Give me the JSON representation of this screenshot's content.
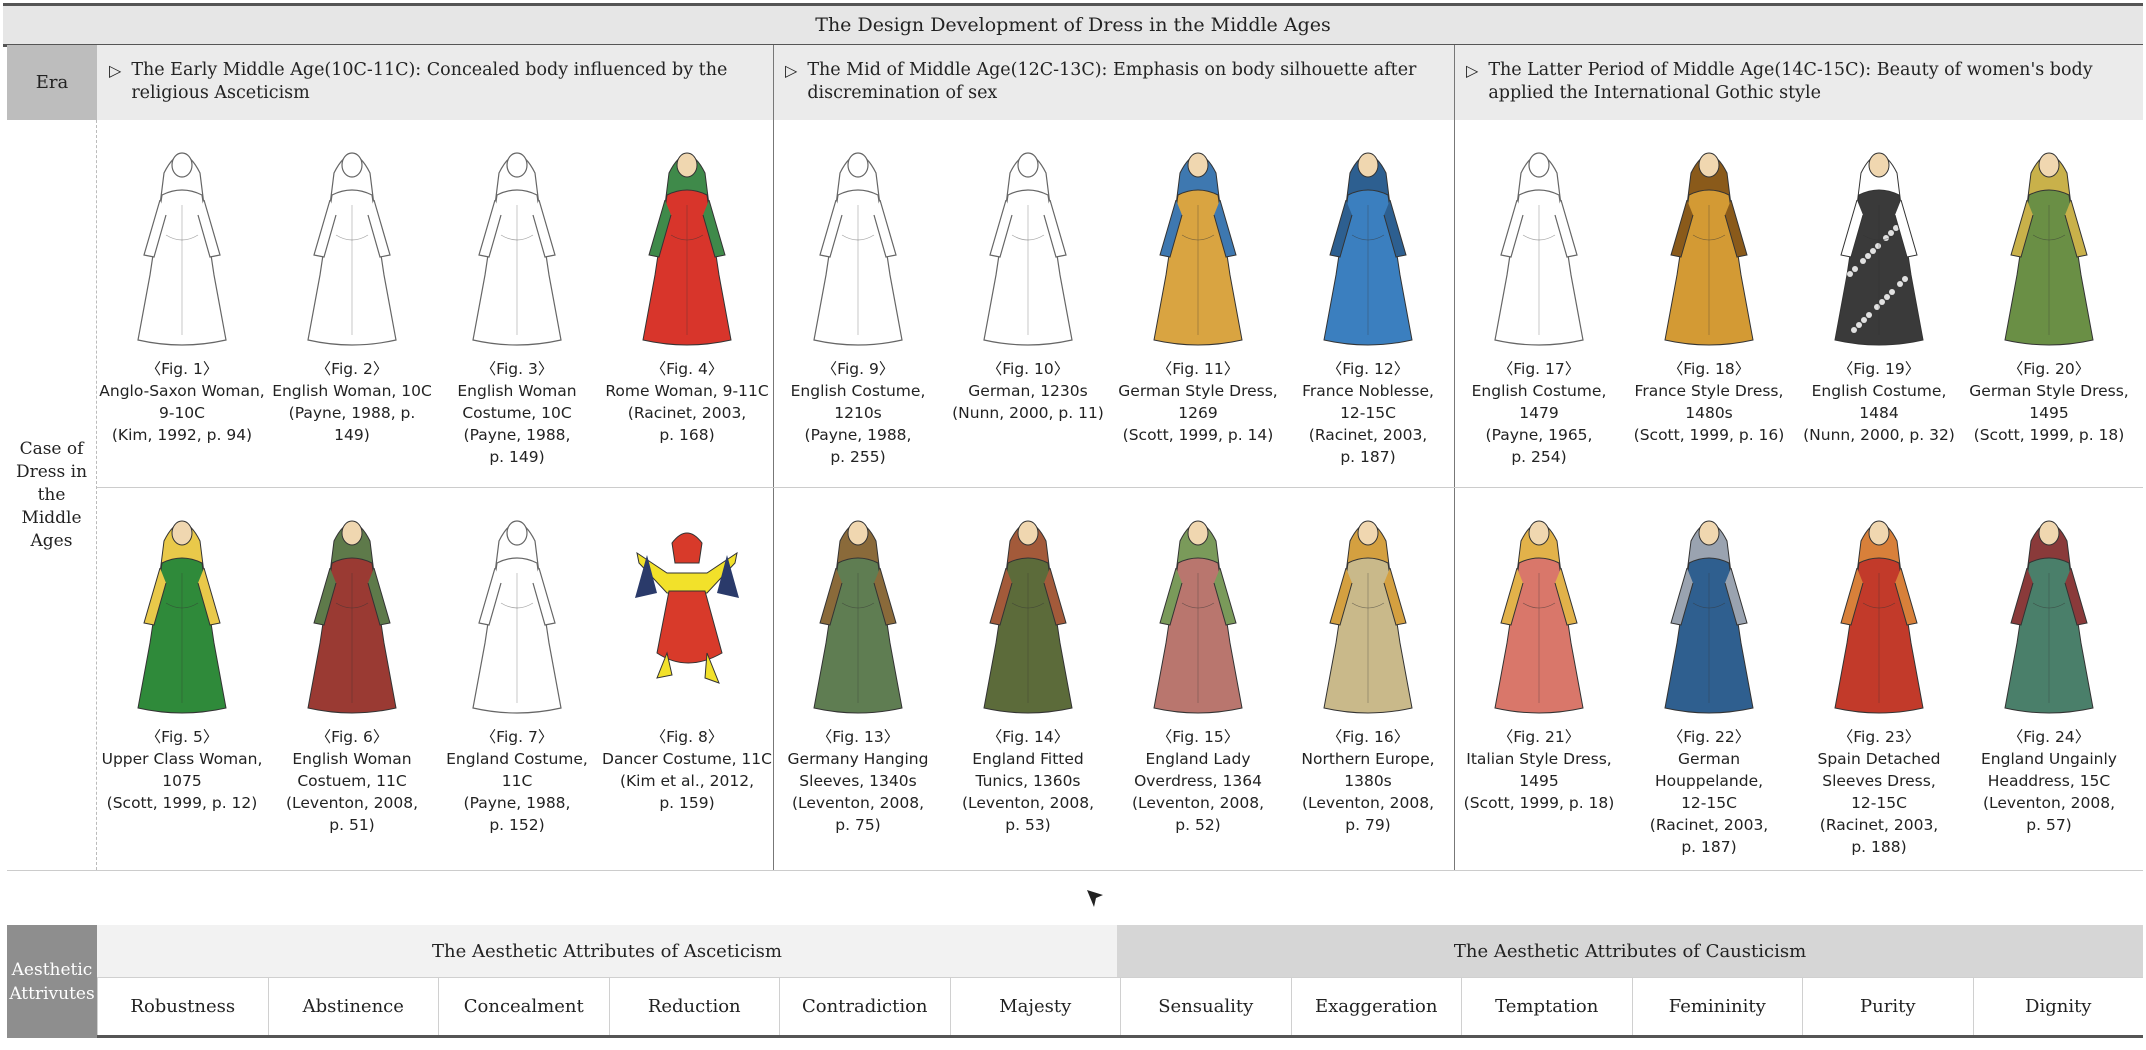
{
  "title": "The Design Development of Dress in the Middle Ages",
  "era_label": "Era",
  "case_label": "Case of\nDress in\nthe\nMiddle\nAges",
  "periods": [
    {
      "text": "The Early Middle Age(10C-11C): Concealed body influenced by the religious Asceticism"
    },
    {
      "text": "The Mid of Middle Age(12C-13C): Emphasis on body silhouette after discremination of sex"
    },
    {
      "text": "The Latter Period of Middle Age(14C-15C): Beauty of women's body applied the International Gothic style"
    }
  ],
  "figures": [
    {
      "num": "〈Fig. 1〉",
      "caption": "Anglo-Saxon Woman,\n9-10C\n(Kim, 1992, p. 94)",
      "style": "sketch",
      "dress": "#ffffff",
      "accent": "#ffffff"
    },
    {
      "num": "〈Fig. 2〉",
      "caption": "English Woman, 10C\n(Payne, 1988, p.\n149)",
      "style": "sketch",
      "dress": "#ffffff",
      "accent": "#ffffff"
    },
    {
      "num": "〈Fig. 3〉",
      "caption": "English Woman\nCostume, 10C\n(Payne, 1988,\np. 149)",
      "style": "sketch",
      "dress": "#ffffff",
      "accent": "#ffffff"
    },
    {
      "num": "〈Fig. 4〉",
      "caption": "Rome Woman, 9-11C\n(Racinet, 2003,\np. 168)",
      "style": "color",
      "dress": "#d8352b",
      "accent": "#3f8a4a"
    },
    {
      "num": "〈Fig. 9〉",
      "caption": "English Costume,\n1210s\n(Payne, 1988,\np. 255)",
      "style": "sketch",
      "dress": "#ffffff",
      "accent": "#ffffff"
    },
    {
      "num": "〈Fig. 10〉",
      "caption": "German, 1230s\n(Nunn, 2000, p. 11)",
      "style": "sketch",
      "dress": "#ffffff",
      "accent": "#ffffff"
    },
    {
      "num": "〈Fig. 11〉",
      "caption": "German Style Dress,\n1269\n(Scott, 1999, p. 14)",
      "style": "color",
      "dress": "#d9a441",
      "accent": "#3e78b0"
    },
    {
      "num": "〈Fig. 12〉",
      "caption": "France Noblesse,\n12-15C\n(Racinet, 2003,\np. 187)",
      "style": "color",
      "dress": "#3b7fbf",
      "accent": "#2d5f90"
    },
    {
      "num": "〈Fig. 17〉",
      "caption": "English Costume,\n1479\n(Payne, 1965,\np. 254)",
      "style": "sketch",
      "dress": "#ffffff",
      "accent": "#ffffff"
    },
    {
      "num": "〈Fig. 18〉",
      "caption": "France Style Dress,\n1480s\n(Scott, 1999, p. 16)",
      "style": "color",
      "dress": "#d39a34",
      "accent": "#8a5a1a"
    },
    {
      "num": "〈Fig. 19〉",
      "caption": "English Costume,\n1484\n(Nunn, 2000, p. 32)",
      "style": "pattern",
      "dress": "#3a3a3a",
      "accent": "#ffffff"
    },
    {
      "num": "〈Fig. 20〉",
      "caption": "German Style Dress,\n1495\n(Scott, 1999, p. 18)",
      "style": "color",
      "dress": "#6a8f45",
      "accent": "#c9b14a"
    },
    {
      "num": "〈Fig. 5〉",
      "caption": "Upper Class Woman,\n1075\n(Scott, 1999, p. 12)",
      "style": "color",
      "dress": "#2f8a3a",
      "accent": "#e9c94a"
    },
    {
      "num": "〈Fig. 6〉",
      "caption": "English Woman\nCostuem, 11C\n(Leventon, 2008,\np. 51)",
      "style": "color",
      "dress": "#9a3a33",
      "accent": "#5e7a4a"
    },
    {
      "num": "〈Fig. 7〉",
      "caption": "England Costume,\n11C\n(Payne, 1988,\np. 152)",
      "style": "sketch",
      "dress": "#ffffff",
      "accent": "#ffffff"
    },
    {
      "num": "〈Fig. 8〉",
      "caption": "Dancer Costume, 11C\n(Kim et al., 2012,\np. 159)",
      "style": "dancer",
      "dress": "#f2e12a",
      "accent": "#d83a2a"
    },
    {
      "num": "〈Fig. 13〉",
      "caption": "Germany Hanging\nSleeves, 1340s\n(Leventon, 2008,\np. 75)",
      "style": "color",
      "dress": "#5f7d52",
      "accent": "#8a6a3a"
    },
    {
      "num": "〈Fig. 14〉",
      "caption": "England Fitted\nTunics, 1360s\n(Leventon, 2008,\np. 53)",
      "style": "color",
      "dress": "#5c6b3a",
      "accent": "#a35a3a"
    },
    {
      "num": "〈Fig. 15〉",
      "caption": "England Lady\nOverdress, 1364\n(Leventon, 2008,\np. 52)",
      "style": "color",
      "dress": "#b9766e",
      "accent": "#7a9a5a"
    },
    {
      "num": "〈Fig. 16〉",
      "caption": "Northern Europe,\n1380s\n(Leventon, 2008,\np. 79)",
      "style": "color",
      "dress": "#c9b98a",
      "accent": "#d4a040"
    },
    {
      "num": "〈Fig. 21〉",
      "caption": "Italian Style Dress,\n1495\n(Scott, 1999, p. 18)",
      "style": "color",
      "dress": "#d9776a",
      "accent": "#e2b24a"
    },
    {
      "num": "〈Fig. 22〉",
      "caption": "German Houppelande,\n12-15C\n(Racinet, 2003,\np. 187)",
      "style": "color",
      "dress": "#2f5f8f",
      "accent": "#9aa3b0"
    },
    {
      "num": "〈Fig. 23〉",
      "caption": "Spain Detached\nSleeves Dress,\n12-15C\n(Racinet, 2003,\np. 188)",
      "style": "color",
      "dress": "#c23a2a",
      "accent": "#d8803a"
    },
    {
      "num": "〈Fig. 24〉",
      "caption": "England Ungainly\nHeaddress, 15C\n(Leventon, 2008,\np. 57)",
      "style": "color",
      "dress": "#4a7f6a",
      "accent": "#8a3a3a"
    }
  ],
  "aesthetic": {
    "label": "Aesthetic\nAttrivutes",
    "group1": "The Aesthetic Attributes of Asceticism",
    "group2": "The Aesthetic Attributes of Causticism",
    "attributes": [
      "Robustness",
      "Abstinence",
      "Concealment",
      "Reduction",
      "Contradiction",
      "Majesty",
      "Sensuality",
      "Exaggeration",
      "Temptation",
      "Femininity",
      "Purity",
      "Dignity"
    ]
  }
}
